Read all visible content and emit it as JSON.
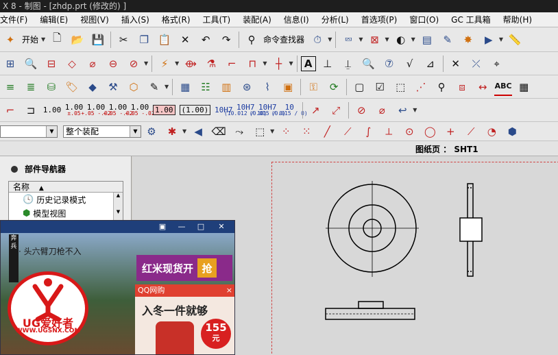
{
  "window": {
    "title": "X 8 - 制图 - [zhdp.prt  (修改的)  ]"
  },
  "menu": [
    "文件(F)",
    "编辑(E)",
    "视图(V)",
    "插入(S)",
    "格式(R)",
    "工具(T)",
    "装配(A)",
    "信息(I)",
    "分析(L)",
    "首选项(P)",
    "窗口(O)",
    "GC 工具箱",
    "帮助(H)"
  ],
  "toolbar1": {
    "start_label": "开始",
    "command_finder_label": "命令查找器"
  },
  "toolbar2": {
    "text_icon_label": "A"
  },
  "toolbar3": {
    "abc_label": "ABC"
  },
  "toolbar4": {
    "tolerances": [
      {
        "main": "1.00",
        "sub": ""
      },
      {
        "main": "1.00",
        "sub": "±.05"
      },
      {
        "main": "1.00",
        "sub": "+.05 -.02"
      },
      {
        "main": "1.00",
        "sub": "+.05 -.02"
      },
      {
        "main": "1.00",
        "sub": "+.05 -.02"
      }
    ],
    "boxed_1": "1.00",
    "boxed_2": "(1.00)",
    "fits": [
      {
        "main": "10H7",
        "sub": ""
      },
      {
        "main": "10H7",
        "sub": "(10.012 / 10)"
      },
      {
        "main": "10H7",
        "sub": "(0.015 / 0)"
      },
      {
        "main": "10",
        "sub": "(0.015 / 0)"
      }
    ]
  },
  "toolbar5": {
    "filter_value": "",
    "assembly_scope": "整个装配"
  },
  "sheet": {
    "label": "图纸页 ： SHT1"
  },
  "navigator": {
    "title": "部件导航器",
    "column_header": "名称",
    "items": [
      "历史记录模式",
      "模型视图"
    ]
  },
  "popup": {
    "floating_text": "· 头六臂刀枪不入",
    "side_tab": "奔兵",
    "banner_text": "红米现货开",
    "banner_badge": "抢",
    "qq_header": "QQ网购",
    "qq_close": "×",
    "qq_promo": "入冬一件就够",
    "price_value": "155",
    "price_unit": "元",
    "logo_text": "UG爱好者",
    "logo_url": "WWW.UGSNX.COM"
  },
  "colors": {
    "accent_red": "#d81818",
    "drawing_border": "#d04040",
    "titlebar": "#1e1e1e"
  }
}
